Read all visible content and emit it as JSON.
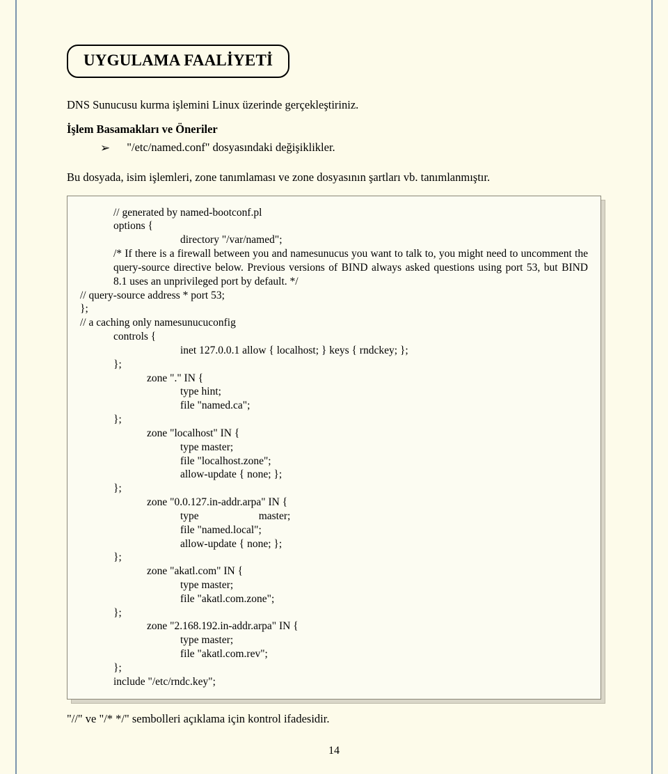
{
  "title": "UYGULAMA FAALİYETİ",
  "intro_line": "DNS Sunucusu kurma işlemini Linux üzerinde gerçekleştiriniz.",
  "steps_heading": "İşlem Basamakları ve Öneriler",
  "bullet_text": "\"/etc/named.conf\" dosyasındaki değişiklikler.",
  "paragraph": "Bu dosyada, isim işlemleri, zone tanımlaması ve zone dosyasının şartları vb. tanımlanmıştır.",
  "code": {
    "l1": "// generated by named-bootconf.pl",
    "l2": "options {",
    "l3": "directory \"/var/named\";",
    "l4": "/* If there is a firewall between you and namesunucus you want to talk to, you might need to uncomment the query-source directive below.  Previous versions of BIND always asked questions using port 53, but BIND 8.1 uses an unprivileged  port by default.   */",
    "l5": "// query-source address * port 53;",
    "l6": "};",
    "l7": "// a caching only namesunucuconfig",
    "l8": "controls {",
    "l9": "inet 127.0.0.1 allow { localhost; } keys { rndckey; };",
    "l10": "};",
    "l11": "zone \".\" IN {",
    "l12": "type hint;",
    "l13": "file \"named.ca\";",
    "l14": "};",
    "l15": "zone \"localhost\" IN {",
    "l16": "type master;",
    "l17": "file \"localhost.zone\";",
    "l18": "allow-update { none; };",
    "l19": "};",
    "l20": "zone \"0.0.127.in-addr.arpa\" IN {",
    "l21a": "type",
    "l21b": "master;",
    "l22": "file \"named.local\";",
    "l23": "allow-update { none; };",
    "l24": "};",
    "l25": "zone \"akatl.com\" IN {",
    "l26": "type master;",
    "l27": "file \"akatl.com.zone\";",
    "l28": "};",
    "l29": "zone \"2.168.192.in-addr.arpa\" IN {",
    "l30": "type master;",
    "l31": "file \"akatl.com.rev\";",
    "l32": "};",
    "l33": "include \"/etc/rndc.key\";"
  },
  "note": "\"//\" ve \"/*   */\"  sembolleri açıklama için kontrol ifadesidir.",
  "page_number": "14"
}
